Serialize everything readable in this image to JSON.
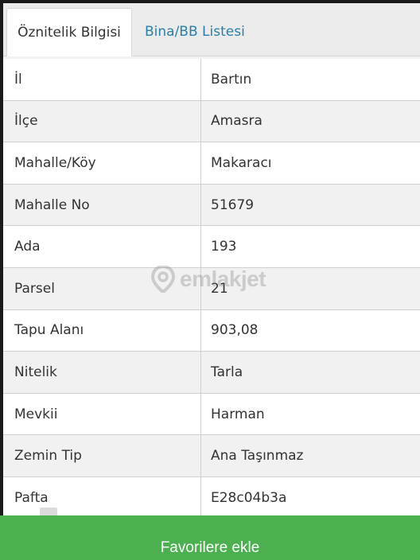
{
  "tabs": {
    "attribute_info": "Öznitelik Bilgisi",
    "building_list": "Bina/BB Listesi"
  },
  "rows": [
    {
      "label": "İl",
      "value": "Bartın"
    },
    {
      "label": "İlçe",
      "value": "Amasra"
    },
    {
      "label": "Mahalle/Köy",
      "value": "Makaracı"
    },
    {
      "label": "Mahalle No",
      "value": "51679"
    },
    {
      "label": "Ada",
      "value": "193"
    },
    {
      "label": "Parsel",
      "value": "21"
    },
    {
      "label": "Tapu Alanı",
      "value": "903,08"
    },
    {
      "label": "Nitelik",
      "value": "Tarla"
    },
    {
      "label": "Mevkii",
      "value": "Harman"
    },
    {
      "label": "Zemin Tip",
      "value": "Ana Taşınmaz"
    },
    {
      "label": "Pafta",
      "value": "E28c04b3a"
    }
  ],
  "watermark": {
    "brand": "emlakjet",
    "icon": "location-pin-icon"
  },
  "button": {
    "add_favorite": "Favorilere ekle"
  },
  "colors": {
    "button_green": "#4caf50",
    "tab_link_blue": "#2a7fa8"
  }
}
